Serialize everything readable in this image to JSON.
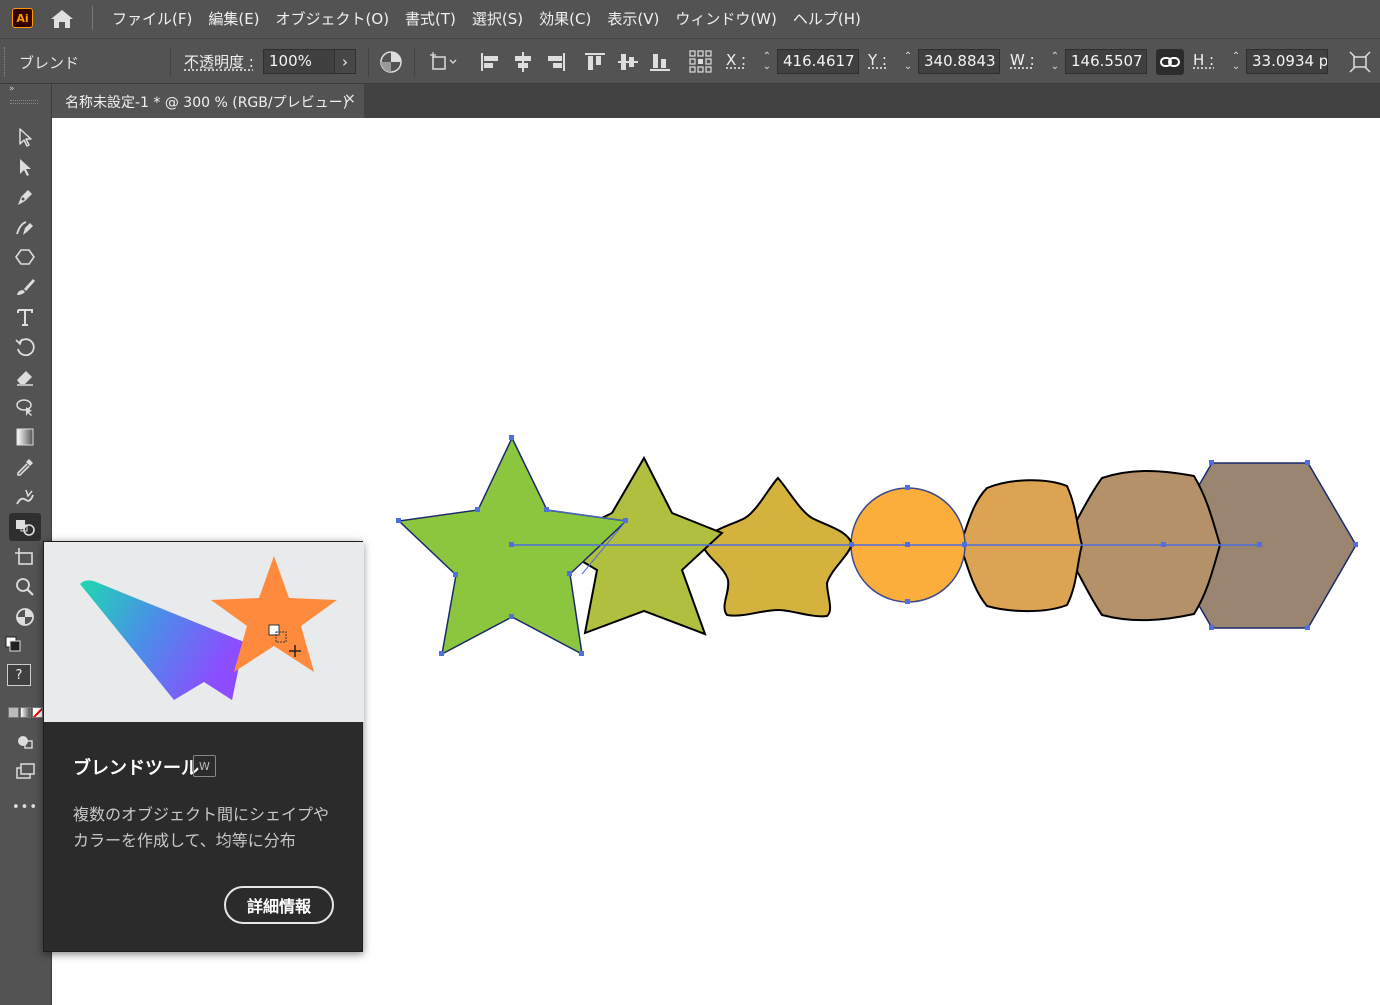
{
  "app": {
    "logo": "Ai"
  },
  "menu": {
    "items": [
      "ファイル(F)",
      "編集(E)",
      "オブジェクト(O)",
      "書式(T)",
      "選択(S)",
      "効果(C)",
      "表示(V)",
      "ウィンドウ(W)",
      "ヘルプ(H)"
    ]
  },
  "control_bar": {
    "selection_label": "ブレンド",
    "opacity_label": "不透明度 :",
    "opacity_value": "100%",
    "opacity_arrow": "›",
    "x_label": "X :",
    "x_value": "416.4617",
    "y_label": "Y :",
    "y_value": "340.8843",
    "w_label": "W :",
    "w_value": "146.5507",
    "h_label": "H :",
    "h_value": "33.0934 p"
  },
  "document_tab": {
    "title": "名称未設定-1 * @ 300 % (RGB/プレビュー)",
    "close": "×"
  },
  "tooltip": {
    "title": "ブレンドツール",
    "shortcut": "W",
    "description": "複数のオブジェクト間にシェイプやカラーを作成して、均等に分布",
    "button_label": "詳細情報"
  },
  "toolbar": {
    "more": "•••",
    "unknown": "?",
    "tools": [
      "selection-tool",
      "direct-selection-tool",
      "pen-tool",
      "curvature-tool",
      "polygon-tool",
      "paintbrush-tool",
      "type-tool",
      "rotate-tool",
      "eraser-tool",
      "puppet-warp-tool",
      "gradient-tool",
      "eyedropper-tool",
      "shape-builder-tool",
      "blend-tool",
      "artboard-tool",
      "zoom-tool",
      "live-paint-tool"
    ]
  },
  "colors": {
    "blend_start": "#8cc63f",
    "blend_end": "#9a8570",
    "accent_selection": "#4f6fdc"
  }
}
